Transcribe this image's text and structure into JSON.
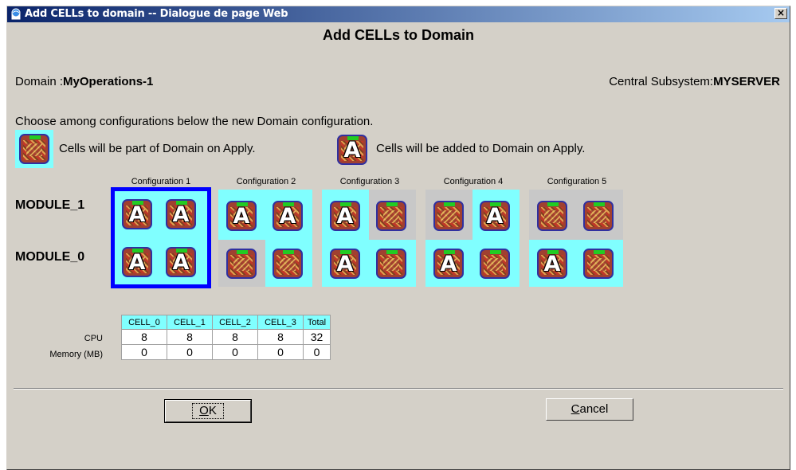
{
  "window": {
    "title": "Add CELLs to domain -- Dialogue de page Web",
    "close_label": "×"
  },
  "heading": "Add CELLs to Domain",
  "domain": {
    "label": "Domain :",
    "value": "MyOperations-1"
  },
  "subsystem": {
    "label": "Central Subsystem:",
    "value": "MYSERVER"
  },
  "instruction": "Choose among configurations below the new Domain configuration.",
  "legend": {
    "part_of_domain": "Cells will be part of Domain on Apply.",
    "added_to_domain": "Cells will be added to Domain on Apply."
  },
  "modules": [
    "MODULE_1",
    "MODULE_0"
  ],
  "configurations": [
    {
      "label": "Configuration 1",
      "selected": true
    },
    {
      "label": "Configuration 2",
      "selected": false
    },
    {
      "label": "Configuration 3",
      "selected": false
    },
    {
      "label": "Configuration 4",
      "selected": false
    },
    {
      "label": "Configuration 5",
      "selected": false
    }
  ],
  "chip_letter": "A",
  "resources": {
    "columns": [
      "CELL_0",
      "CELL_1",
      "CELL_2",
      "CELL_3",
      "Total"
    ],
    "rows": [
      {
        "label": "CPU",
        "values": [
          "8",
          "8",
          "8",
          "8",
          "32"
        ]
      },
      {
        "label": "Memory (MB)",
        "values": [
          "0",
          "0",
          "0",
          "0",
          "0"
        ]
      }
    ]
  },
  "buttons": {
    "ok_prefix": "",
    "ok_underline": "O",
    "ok_rest": "K",
    "cancel_underline": "C",
    "cancel_rest": "ancel"
  },
  "colors": {
    "selection_cyan": "#80ffff",
    "selected_border": "#0000ff",
    "title_start": "#0a246a",
    "title_end": "#a6caf0"
  }
}
